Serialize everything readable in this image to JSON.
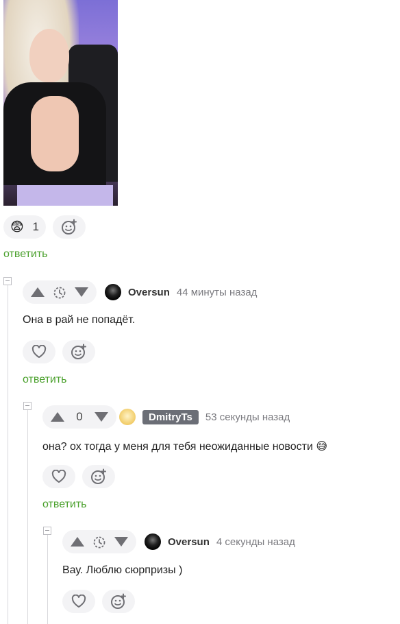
{
  "post": {
    "reactions": {
      "emoji": "😨",
      "count": "1"
    },
    "reply_label": "ответить"
  },
  "comments": [
    {
      "score": "",
      "user": "Oversun",
      "time": "44 минуты назад",
      "text": "Она в рай не попадёт.",
      "reply_label": "ответить"
    },
    {
      "score": "0",
      "user": "DmitryTs",
      "time": "53 секунды назад",
      "text": "она? ох тогда у меня для тебя неожиданные новости 😅",
      "reply_label": "ответить"
    },
    {
      "score": "",
      "user": "Oversun",
      "time": "4 секунды назад",
      "text": "Вау. Люблю сюрпризы )"
    }
  ],
  "icons": {
    "add_reaction": "add-reaction-icon",
    "heart": "heart-icon",
    "timer": "timer-icon",
    "vote_up": "arrow-up-icon",
    "vote_down": "arrow-down-icon",
    "collapse": "collapse-icon"
  },
  "colors": {
    "reply_link": "#4aa02c",
    "pill_bg": "#f3f3f5",
    "badge_bg": "#6b6e76"
  }
}
